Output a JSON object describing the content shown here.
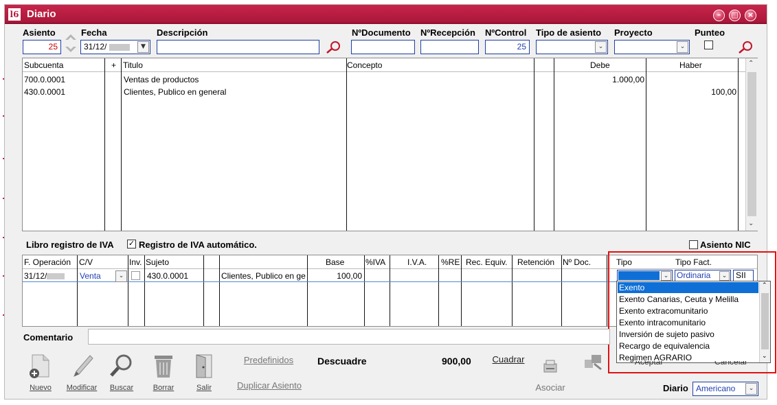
{
  "window": {
    "title": "Diario",
    "app_icon": "l6",
    "controls": {
      "minimize": "–",
      "restore": "□",
      "close": "×"
    }
  },
  "header": {
    "asiento": {
      "label": "Asiento",
      "value": "25"
    },
    "fecha": {
      "label": "Fecha",
      "value": "31/12/"
    },
    "descripcion": {
      "label": "Descripción",
      "value": ""
    },
    "n_documento": {
      "label": "NºDocumento",
      "value": ""
    },
    "n_recepcion": {
      "label": "NºRecepción",
      "value": ""
    },
    "n_control": {
      "label": "NºControl",
      "value": "25"
    },
    "tipo_asiento": {
      "label": "Tipo de asiento",
      "value": ""
    },
    "proyecto": {
      "label": "Proyecto",
      "value": ""
    },
    "punteo": {
      "label": "Punteo",
      "checked": false
    }
  },
  "entries": {
    "headers": {
      "subcuenta": "Subcuenta",
      "plus": "+",
      "titulo": "Titulo",
      "concepto": "Concepto",
      "debe": "Debe",
      "haber": "Haber"
    },
    "rows": [
      {
        "subcuenta": "700.0.0001",
        "titulo": "Ventas de productos",
        "concepto": "",
        "debe": "1.000,00",
        "haber": ""
      },
      {
        "subcuenta": "430.0.0001",
        "titulo": "Clientes, Publico en general",
        "concepto": "",
        "debe": "",
        "haber": "100,00"
      }
    ]
  },
  "iva": {
    "section_label": "Libro registro de IVA",
    "auto_label": "Registro de IVA automático.",
    "auto_checked": true,
    "nic_label": "Asiento NIC",
    "nic_checked": false,
    "headers": {
      "f_operacion": "F. Operación",
      "cv": "C/V",
      "inv": "Inv.",
      "sujeto": "Sujeto",
      "base": "Base",
      "piva": "%IVA",
      "iva": "I.V.A.",
      "pre": "%RE",
      "rec": "Rec. Equiv.",
      "ret": "Retención",
      "ndoc": "Nº Doc.",
      "tipo": "Tipo",
      "tipo_fact": "Tipo Fact."
    },
    "row": {
      "f_operacion": "31/12/",
      "cv": "Venta",
      "sujeto": "430.0.0001",
      "nombre": "Clientes, Publico en ge",
      "base": "100,00",
      "tipo": "",
      "tipo_fact": "Ordinaria",
      "sii": "SII"
    }
  },
  "dropdown": {
    "options": [
      "Exento",
      "Exento Canarias, Ceuta y Melilla",
      "Exento extracomunitario",
      "Exento intracomunitario",
      "Inversión de sujeto pasivo",
      "Recargo de equivalencia",
      "Regimen AGRARIO"
    ],
    "selected": "Exento",
    "hidden_behind": {
      "aceptar": "Aceptar",
      "cancelar": "Cancelar"
    }
  },
  "comentario": {
    "label": "Comentario",
    "value": ""
  },
  "toolbar": {
    "nuevo": "Nuevo",
    "modificar": "Modificar",
    "buscar": "Buscar",
    "borrar": "Borrar",
    "salir": "Salir",
    "predefinidos": "Predefinidos",
    "duplicar": "Duplicar Asiento",
    "descuadre_label": "Descuadre",
    "descuadre_value": "900,00",
    "cuadrar": "Cuadrar",
    "asociar": "Asociar"
  },
  "diario": {
    "label": "Diario",
    "value": "Americano"
  },
  "colors": {
    "title_bar": "#b81c41",
    "highlight_border": "#e01010",
    "selection": "#0f6fd6",
    "input_border": "#1e3fa0"
  }
}
